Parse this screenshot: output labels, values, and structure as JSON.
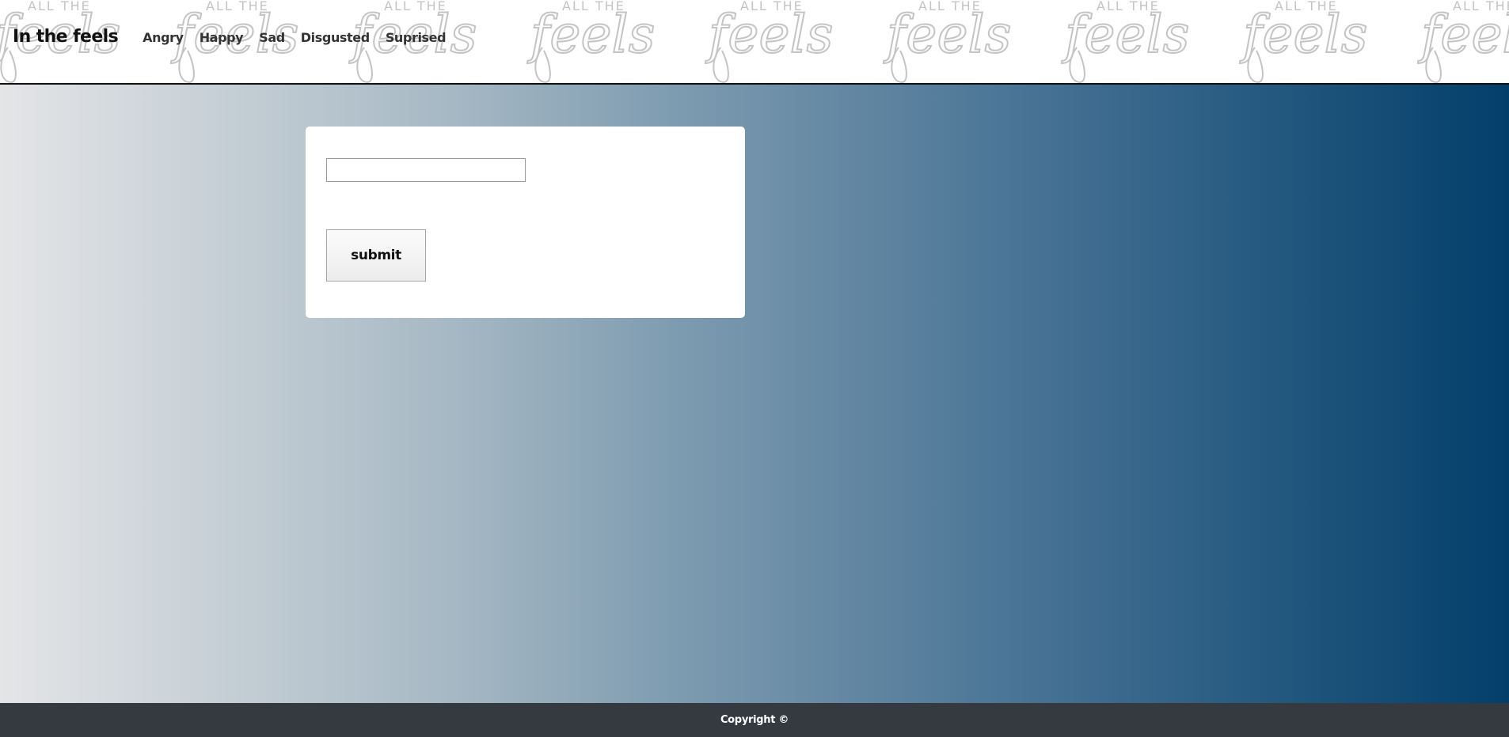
{
  "header": {
    "brand": "In the feels",
    "nav": [
      {
        "label": "Angry"
      },
      {
        "label": "Happy"
      },
      {
        "label": "Sad"
      },
      {
        "label": "Disgusted"
      },
      {
        "label": "Suprised"
      }
    ],
    "pattern": {
      "small_text": "ALL THE",
      "script_text": "feels",
      "color": "#c4c4c4"
    }
  },
  "form": {
    "input_value": "",
    "submit_label": "submit"
  },
  "footer": {
    "text": "Copyright ©"
  },
  "colors": {
    "gradient_start": "#e4e5e7",
    "gradient_end": "#023f6a",
    "footer_bg": "#343a40"
  }
}
